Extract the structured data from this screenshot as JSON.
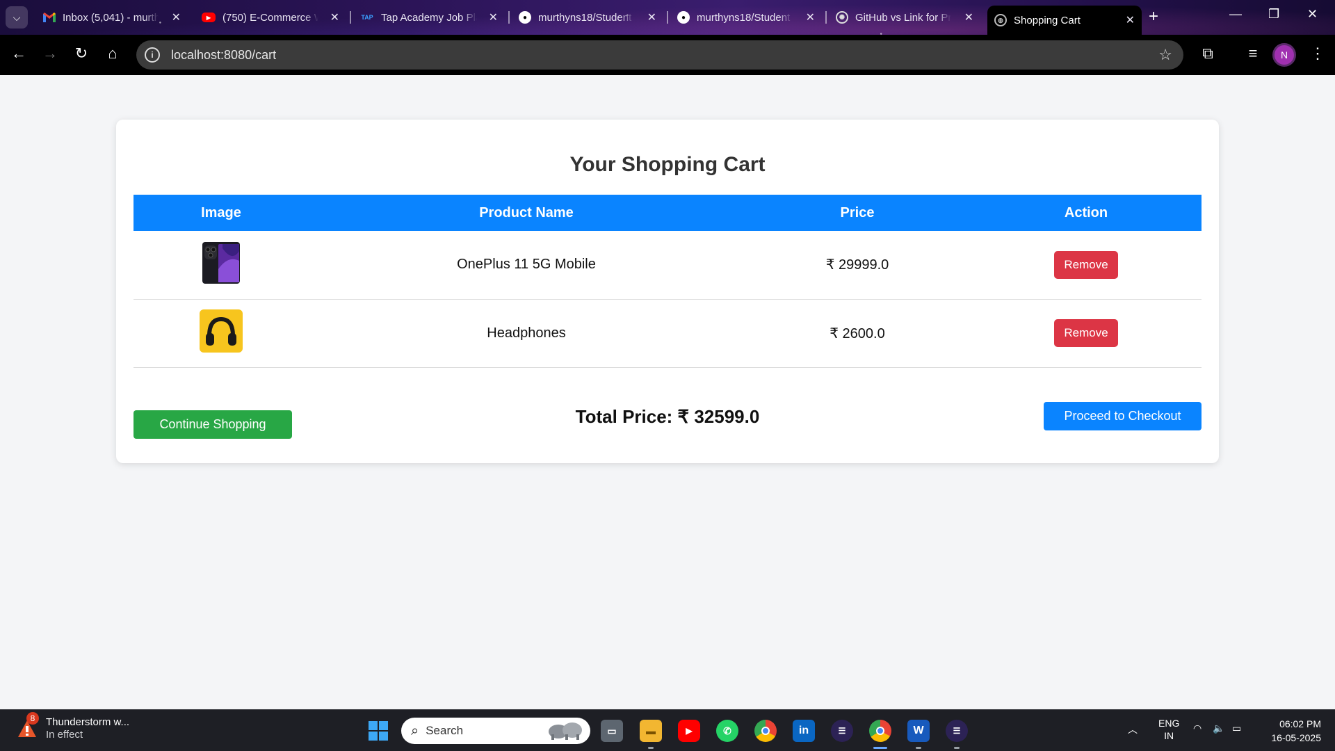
{
  "browser": {
    "tabs": [
      {
        "title": "Inbox (5,041) - murth",
        "icon": "gmail-icon"
      },
      {
        "title": "(750) E-Commerce W",
        "icon": "youtube-icon"
      },
      {
        "title": "Tap Academy Job Pla",
        "icon": "tap-academy-icon"
      },
      {
        "title": "murthyns18/Student",
        "icon": "github-icon"
      },
      {
        "title": "murthyns18/Student",
        "icon": "github-icon"
      },
      {
        "title": "GitHub vs Link for Pr",
        "icon": "chatgpt-icon"
      },
      {
        "title": "Shopping Cart",
        "icon": "globe-icon",
        "active": true
      }
    ],
    "url": "localhost:8080/cart",
    "profile_initial": "N"
  },
  "page": {
    "title": "Your Shopping Cart",
    "columns": [
      "Image",
      "Product Name",
      "Price",
      "Action"
    ],
    "items": [
      {
        "name": "OnePlus 11 5G Mobile",
        "price": "₹ 29999.0",
        "action": "Remove",
        "thumb": "phone-image"
      },
      {
        "name": "Headphones",
        "price": "₹ 2600.0",
        "action": "Remove",
        "thumb": "headphones-image"
      }
    ],
    "continue_label": "Continue Shopping",
    "total_label": "Total Price: ₹ 32599.0",
    "checkout_label": "Proceed to Checkout"
  },
  "taskbar": {
    "weather_badge": "8",
    "weather_title": "Thunderstorm w...",
    "weather_sub": "In effect",
    "search_placeholder": "Search",
    "lang_top": "ENG",
    "lang_bottom": "IN",
    "time": "06:02 PM",
    "date": "16-05-2025"
  },
  "colors": {
    "primary": "#0a84ff",
    "danger": "#dc3545",
    "success": "#28a745"
  }
}
